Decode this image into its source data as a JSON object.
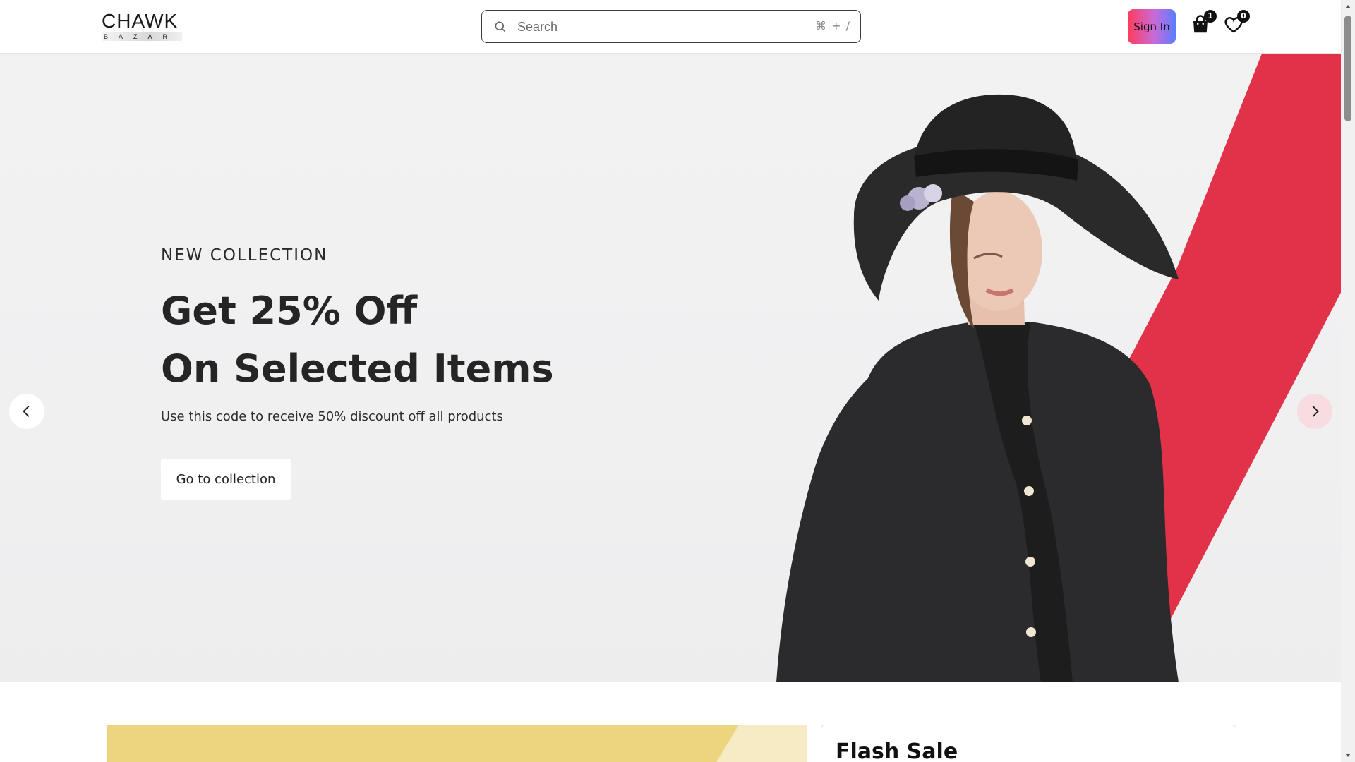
{
  "header": {
    "logo_main": "CHAWK",
    "logo_sub": "BAZAR",
    "search_placeholder": "Search",
    "search_shortcut": "⌘ + /",
    "signin_label": "Sign In",
    "cart_count": "1",
    "wishlist_count": "0"
  },
  "hero": {
    "eyebrow": "NEW COLLECTION",
    "headline_line1": "Get 25% Off",
    "headline_line2": "On Selected Items",
    "subline": "Use this code to receive 50% discount off all products",
    "cta_label": "Go to collection",
    "accent_color": "#e2324a"
  },
  "below": {
    "flash_title": "Flash Sale",
    "promo_color": "#ecd57e"
  },
  "icons": [
    "search-icon",
    "shopping-bag-icon",
    "heart-icon",
    "chevron-left-icon",
    "chevron-right-icon"
  ]
}
